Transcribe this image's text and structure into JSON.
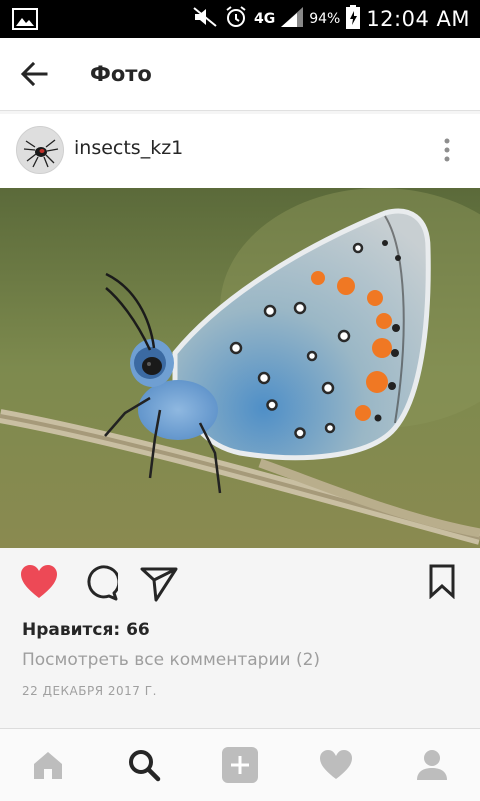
{
  "status_bar": {
    "battery_percent": "94%",
    "time": "12:04 AM",
    "network": "4G",
    "icons": [
      "image-icon",
      "mute-icon",
      "alarm-icon",
      "signal-icon",
      "battery-icon"
    ]
  },
  "header": {
    "title": "Фото",
    "back_icon": "arrow-left-icon"
  },
  "post": {
    "username": "insects_kz1",
    "more_icon": "more-vertical-icon",
    "photo_subject": "blue butterfly on a dry stem",
    "likes_label": "Нравится: 66",
    "view_comments": "Посмотреть все комментарии (2)",
    "date": "22 ДЕКАБРЯ 2017 Г.",
    "liked": true
  },
  "actions": {
    "like_icon": "heart-icon",
    "comment_icon": "comment-icon",
    "share_icon": "send-icon",
    "save_icon": "bookmark-icon"
  },
  "bottom_nav": {
    "items": [
      "home-icon",
      "search-icon",
      "add-icon",
      "activity-icon",
      "profile-icon"
    ],
    "active": "search-icon"
  },
  "colors": {
    "like_red": "#ed4956",
    "text_dark": "#262626",
    "text_gray": "#9e9e9e"
  }
}
